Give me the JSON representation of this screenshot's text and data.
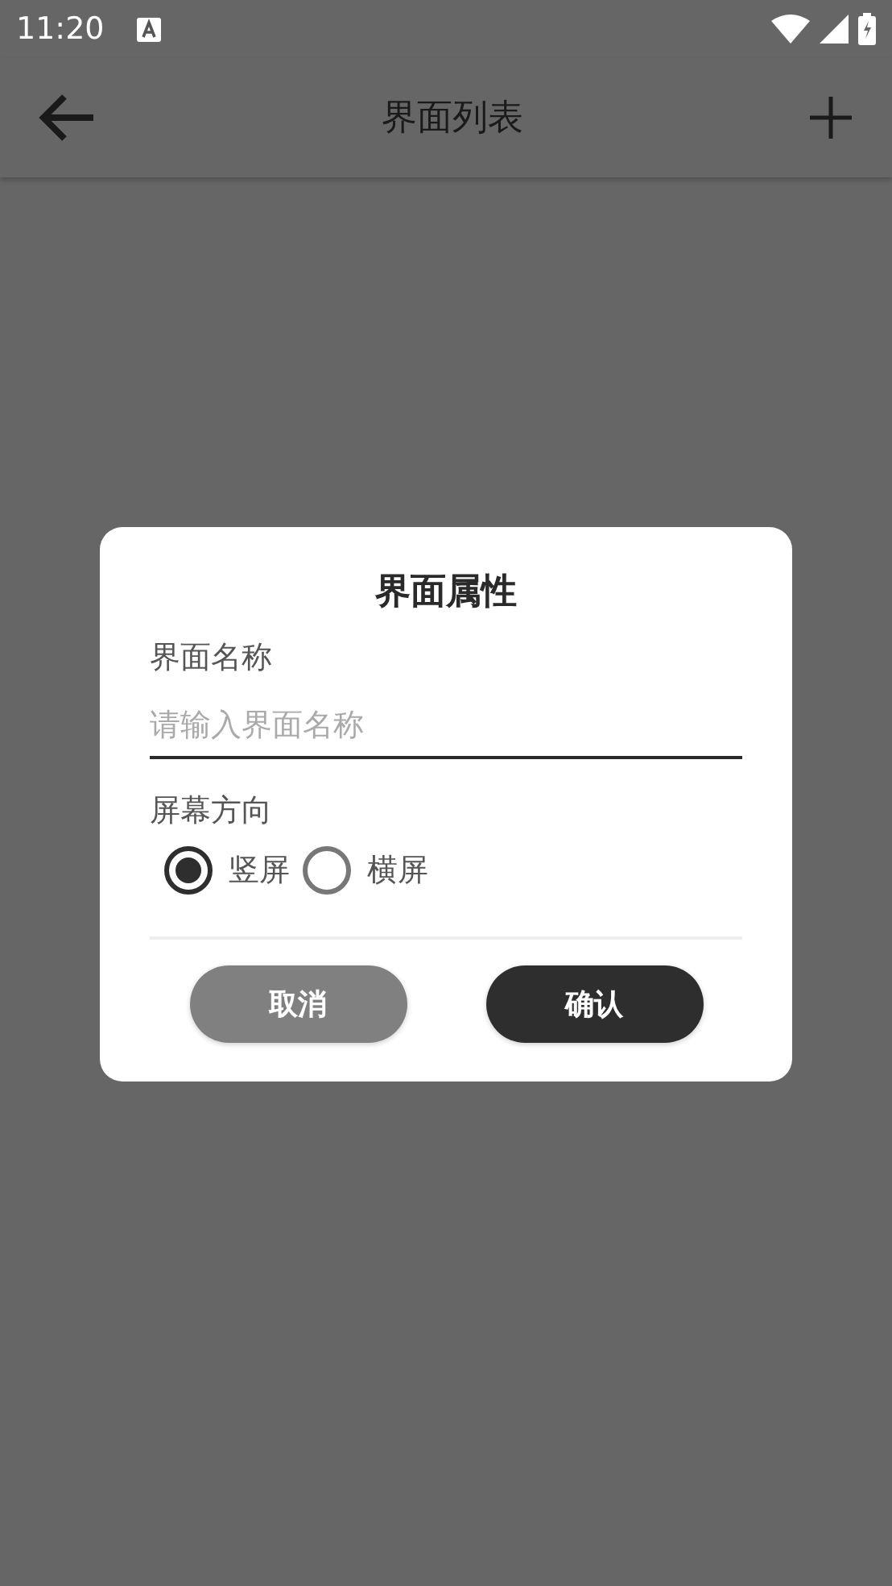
{
  "status_bar": {
    "time": "11:20"
  },
  "app_bar": {
    "title": "界面列表"
  },
  "dialog": {
    "title": "界面属性",
    "name_field": {
      "label": "界面名称",
      "placeholder": "请输入界面名称"
    },
    "orientation": {
      "label": "屏幕方向",
      "options": [
        {
          "label": "竖屏",
          "selected": true
        },
        {
          "label": "横屏",
          "selected": false
        }
      ]
    },
    "buttons": [
      {
        "label": "取消",
        "kind": "secondary"
      },
      {
        "label": "确认",
        "kind": "primary"
      }
    ]
  }
}
